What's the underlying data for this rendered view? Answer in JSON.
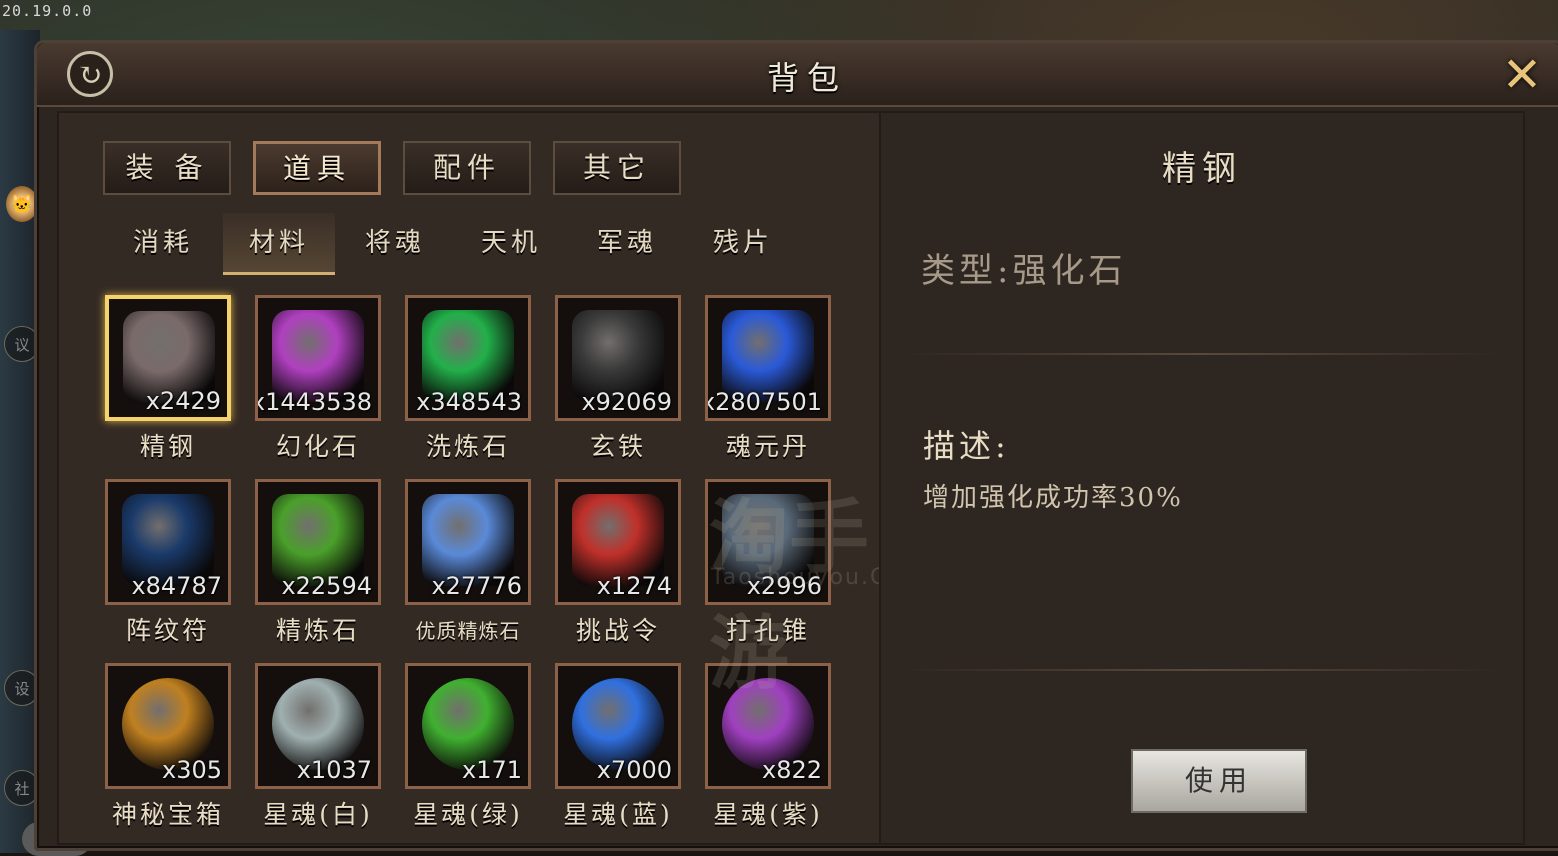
{
  "version": "20.19.0.0",
  "window": {
    "title": "背包"
  },
  "main_tabs": [
    {
      "label": "装 备",
      "active": false
    },
    {
      "label": "道具",
      "active": true
    },
    {
      "label": "配件",
      "active": false
    },
    {
      "label": "其它",
      "active": false
    }
  ],
  "sub_tabs": [
    {
      "label": "消耗",
      "active": false
    },
    {
      "label": "材料",
      "active": true
    },
    {
      "label": "将魂",
      "active": false
    },
    {
      "label": "天机",
      "active": false
    },
    {
      "label": "军魂",
      "active": false
    },
    {
      "label": "残片",
      "active": false
    }
  ],
  "items": [
    {
      "name": "精钢",
      "count": "x2429",
      "icon": "steel-ore-icon",
      "color": "#7a6a6a",
      "selected": true
    },
    {
      "name": "幻化石",
      "count": "x1443538",
      "icon": "illusion-stone-icon",
      "color": "#b040c0"
    },
    {
      "name": "洗炼石",
      "count": "x348543",
      "icon": "refining-crystal-icon",
      "color": "#22b04a"
    },
    {
      "name": "玄铁",
      "count": "x92069",
      "icon": "black-iron-icon",
      "color": "#3a3a3a"
    },
    {
      "name": "魂元丹",
      "count": "x2807501",
      "icon": "soul-pill-icon",
      "color": "#2a5ad8"
    },
    {
      "name": "阵纹符",
      "count": "x84787",
      "icon": "formation-scroll-icon",
      "color": "#1a3a6a"
    },
    {
      "name": "精炼石",
      "count": "x22594",
      "icon": "green-gem-icon",
      "color": "#4aa02a"
    },
    {
      "name": "优质精炼石",
      "count": "x27776",
      "icon": "blue-gem-icon",
      "color": "#5a8ad8"
    },
    {
      "name": "挑战令",
      "count": "x1274",
      "icon": "challenge-token-icon",
      "color": "#c0302a"
    },
    {
      "name": "打孔锥",
      "count": "x2996",
      "icon": "awl-icon",
      "color": "#5a6a7a"
    },
    {
      "name": "神秘宝箱",
      "count": "x305",
      "icon": "treasure-chest-icon",
      "color": "#c08020"
    },
    {
      "name": "星魂(白)",
      "count": "x1037",
      "icon": "white-star-orb-icon",
      "color": "#a0b0b0"
    },
    {
      "name": "星魂(绿)",
      "count": "x171",
      "icon": "green-star-orb-icon",
      "color": "#40b030"
    },
    {
      "name": "星魂(蓝)",
      "count": "x7000",
      "icon": "blue-star-orb-icon",
      "color": "#3070e0"
    },
    {
      "name": "星魂(紫)",
      "count": "x822",
      "icon": "purple-star-orb-icon",
      "color": "#a040c0"
    }
  ],
  "detail": {
    "name": "精钢",
    "type_line": "类型:强化石",
    "desc_label": "描述:",
    "desc_text": "增加强化成功率30%",
    "use_button": "使用"
  },
  "watermark": {
    "main": "淘手游",
    "sub": "Taoshouyou.Com"
  },
  "sidebar": {
    "avatar_icon": "cat-avatar-icon",
    "more": "···"
  }
}
